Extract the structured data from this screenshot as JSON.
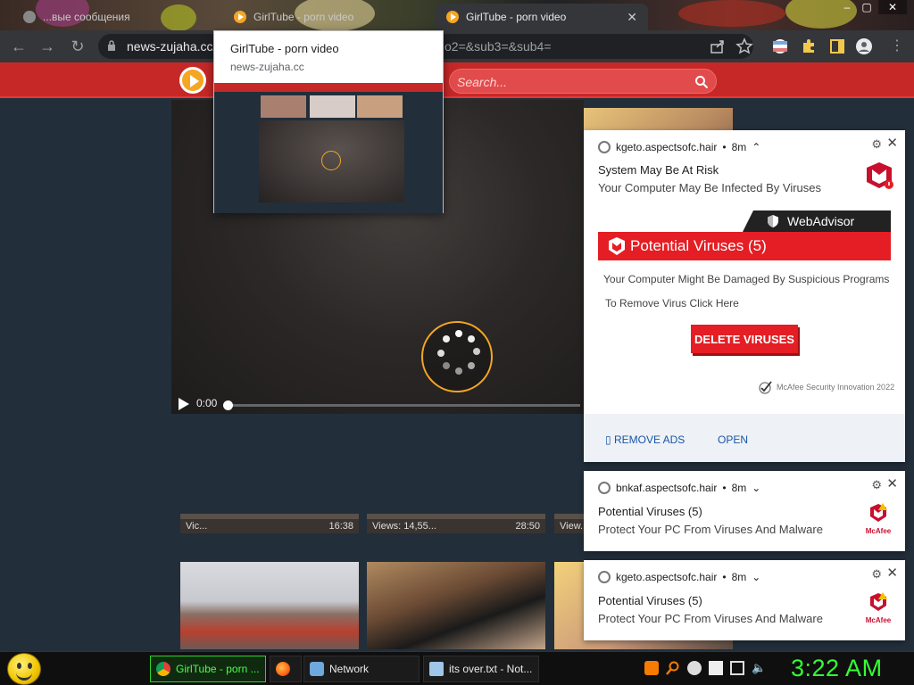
{
  "browser": {
    "tabs": [
      {
        "label": "...вые сообщения",
        "active": false
      },
      {
        "label": "GirlTube - porn video",
        "active": false
      },
      {
        "label": "GirlTube - porn video",
        "active": true
      }
    ],
    "url_host": "news-zujaha.cc/",
    "url_tail": "o2=&sub3=&sub4="
  },
  "tab_preview": {
    "title": "GirlTube - porn video",
    "host": "news-zujaha.cc"
  },
  "site": {
    "search_placeholder": "Search...",
    "brand_color": "#c62828"
  },
  "player": {
    "time": "0:00"
  },
  "thumbnails": [
    {
      "meta_left": "Vic...",
      "meta_right": "16:38"
    },
    {
      "meta_left": "Views: 14,55...",
      "meta_right": "28:50"
    },
    {
      "meta_left": "View...",
      "meta_right": ""
    }
  ],
  "notifications": [
    {
      "source": "kgeto.aspectsofc.hair",
      "age": "8m",
      "title": "System May Be At Risk",
      "message": "Your Computer May Be Infected By Viruses",
      "advisor": "WebAdvisor",
      "banner": "Potential Viruses (5)",
      "body1": "Your Computer Might Be Damaged By Suspicious Programs",
      "body2": "To Remove Virus Click Here",
      "button": "DELETE VIRUSES",
      "copyright": "McAfee Security Innovation 2022",
      "action1": "▯ REMOVE ADS",
      "action2": "OPEN"
    },
    {
      "source": "bnkaf.aspectsofc.hair",
      "age": "8m",
      "title": "Potential Viruses (5)",
      "message": "Protect Your PC From Viruses And Malware",
      "logo_text": "McAfee"
    },
    {
      "source": "kgeto.aspectsofc.hair",
      "age": "8m",
      "title": "Potential Viruses (5)",
      "message": "Protect Your PC From Viruses And Malware",
      "logo_text": "McAfee"
    }
  ],
  "taskbar": {
    "tasks": [
      {
        "label": "GirlTube - porn ...",
        "icon": "chrome-icon"
      },
      {
        "label": "",
        "icon": "firefox-icon"
      },
      {
        "label": "Network",
        "icon": "network-icon"
      },
      {
        "label": "its over.txt - Not...",
        "icon": "notepad-icon"
      }
    ],
    "clock": "3:22 AM"
  }
}
